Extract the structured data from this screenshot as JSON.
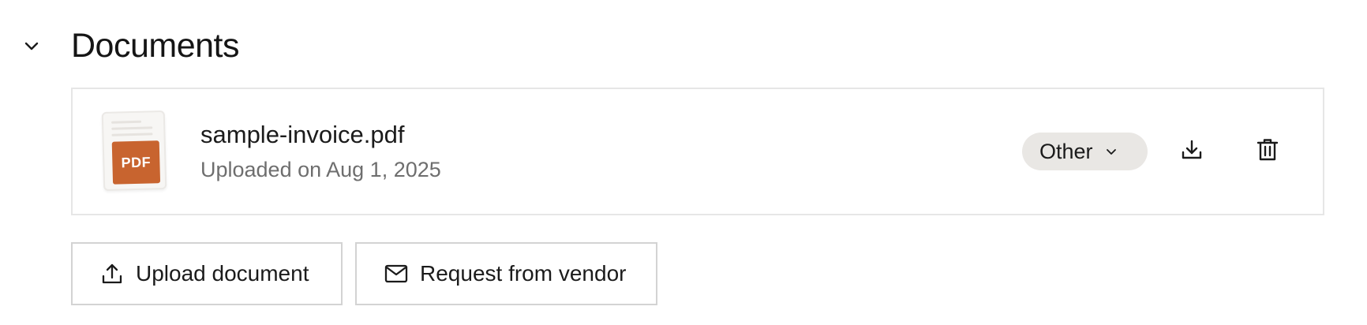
{
  "section": {
    "title": "Documents",
    "toggle_icon": "chevron-down-icon"
  },
  "document": {
    "file_name": "sample-invoice.pdf",
    "uploaded_text": "Uploaded on Aug 1, 2025",
    "thumb_badge": "PDF",
    "badge_color": "#c8642f",
    "category": {
      "selected": "Other",
      "icon": "chevron-down-icon"
    },
    "actions": {
      "download_icon": "download-icon",
      "delete_icon": "trash-icon"
    }
  },
  "buttons": {
    "upload_label": "Upload document",
    "upload_icon": "upload-icon",
    "request_label": "Request from vendor",
    "request_icon": "mail-icon"
  }
}
